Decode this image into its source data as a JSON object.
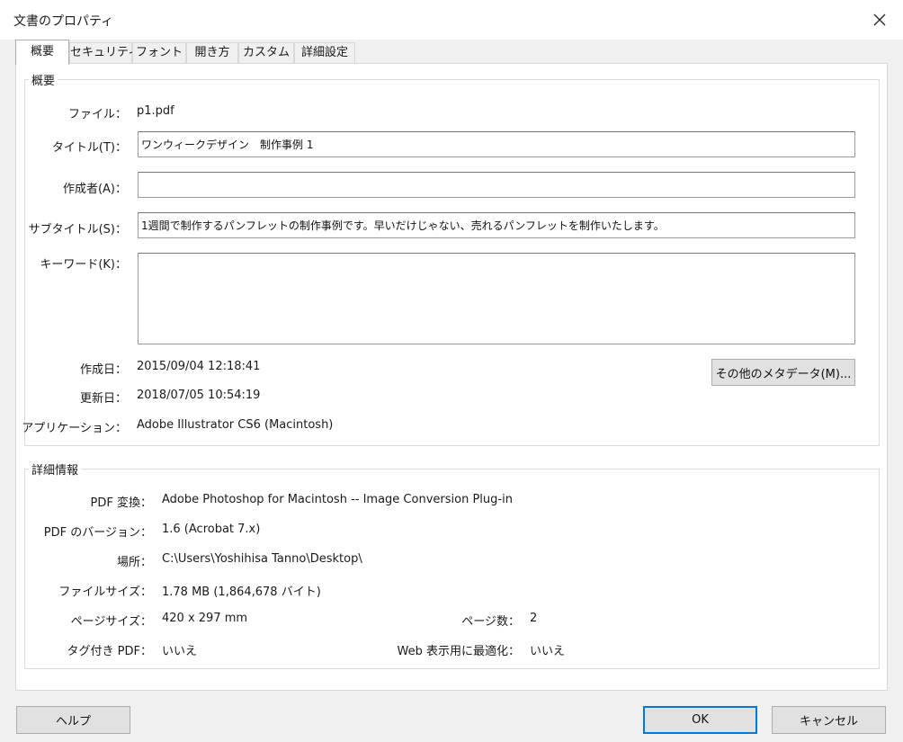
{
  "window": {
    "title": "文書のプロパティ"
  },
  "tabs": [
    {
      "label": "概要",
      "active": true
    },
    {
      "label": "セキュリティ"
    },
    {
      "label": "フォント"
    },
    {
      "label": "開き方"
    },
    {
      "label": "カスタム"
    },
    {
      "label": "詳細設定"
    }
  ],
  "summary": {
    "legend": "概要",
    "file_label": "ファイル：",
    "file_value": "p1.pdf",
    "title_label": "タイトル(T)：",
    "title_value": "ワンウィークデザイン　制作事例 1",
    "author_label": "作成者(A)：",
    "author_value": "",
    "subject_label": "サブタイトル(S)：",
    "subject_value": "1週間で制作するパンフレットの制作事例です。早いだけじゃない、売れるパンフレットを制作いたします。",
    "keywords_label": "キーワード(K)：",
    "keywords_value": "",
    "created_label": "作成日：",
    "created_value": "2015/09/04 12:18:41",
    "modified_label": "更新日：",
    "modified_value": "2018/07/05 10:54:19",
    "app_label": "アプリケーション：",
    "app_value": "Adobe Illustrator CS6 (Macintosh)",
    "more_metadata_button": "その他のメタデータ(M)..."
  },
  "details": {
    "legend": "詳細情報",
    "producer_label": "PDF 変換：",
    "producer_value": "Adobe Photoshop for Macintosh -- Image Conversion Plug-in",
    "version_label": "PDF のバージョン：",
    "version_value": "1.6 (Acrobat 7.x)",
    "location_label": "場所：",
    "location_value": "C:\\Users\\Yoshihisa Tanno\\Desktop\\",
    "filesize_label": "ファイルサイズ：",
    "filesize_value": "1.78 MB (1,864,678 バイト)",
    "pagesize_label": "ページサイズ：",
    "pagesize_value": "420 x 297 mm",
    "pagecount_label": "ページ数：",
    "pagecount_value": "2",
    "tagged_label": "タグ付き PDF：",
    "tagged_value": "いいえ",
    "fastweb_label": "Web 表示用に最適化：",
    "fastweb_value": "いいえ"
  },
  "buttons": {
    "help": "ヘルプ",
    "ok": "OK",
    "cancel": "キャンセル"
  },
  "icons": {
    "close": "close-icon"
  },
  "colors": {
    "dialog_bg": "#f0f0f0",
    "panel_bg": "#ffffff",
    "focus_border": "#0078d7"
  }
}
